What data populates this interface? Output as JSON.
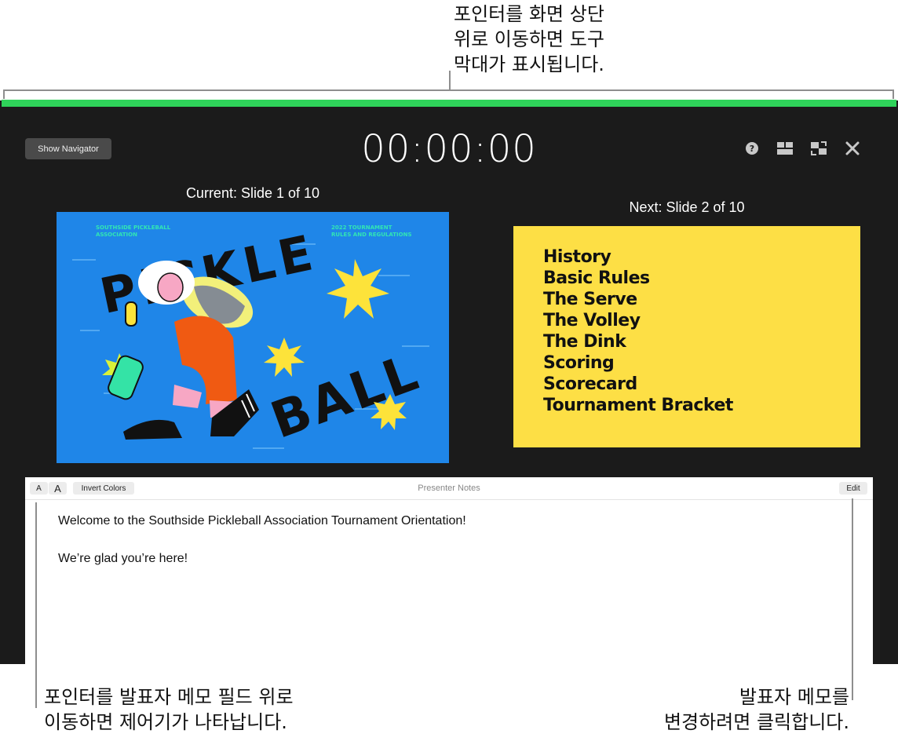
{
  "callouts": {
    "top": [
      "포인터를 화면 상단",
      "위로 이동하면 도구",
      "막대가 표시됩니다."
    ],
    "bottom_left": [
      "포인터를 발표자 메모 필드 위로",
      "이동하면 제어기가 나타납니다."
    ],
    "bottom_right": [
      "발표자 메모를",
      "변경하려면 클릭합니다."
    ]
  },
  "toolbar": {
    "show_navigator_label": "Show Navigator",
    "timer": "00:00:00",
    "icons": [
      "help-icon",
      "layout-icon",
      "swap-displays-icon",
      "close-icon"
    ]
  },
  "current": {
    "label": "Current: Slide 1 of 10",
    "slide": {
      "org": [
        "SOUTHSIDE PICKLEBALL",
        "ASSOCIATION"
      ],
      "event": [
        "2022 TOURNAMENT",
        "RULES AND REGULATIONS"
      ],
      "title_word1": "PICKLE",
      "title_word2": "BALL",
      "background_color": "#1f86e8"
    }
  },
  "next": {
    "label": "Next: Slide 2 of 10",
    "background_color": "#fddf45",
    "items": [
      "History",
      "Basic Rules",
      "The Serve",
      "The Volley",
      "The Dink",
      "Scoring",
      "Scorecard",
      "Tournament Bracket"
    ]
  },
  "notes": {
    "font_smaller_label": "A",
    "font_larger_label": "A",
    "invert_colors_label": "Invert Colors",
    "title": "Presenter Notes",
    "edit_label": "Edit",
    "paragraphs": [
      "Welcome to the Southside Pickleball Association Tournament Orientation!",
      "We’re glad you’re here!"
    ]
  },
  "colors": {
    "toolbar_highlight": "#2fd35a",
    "presenter_background": "#1b1b1b"
  }
}
